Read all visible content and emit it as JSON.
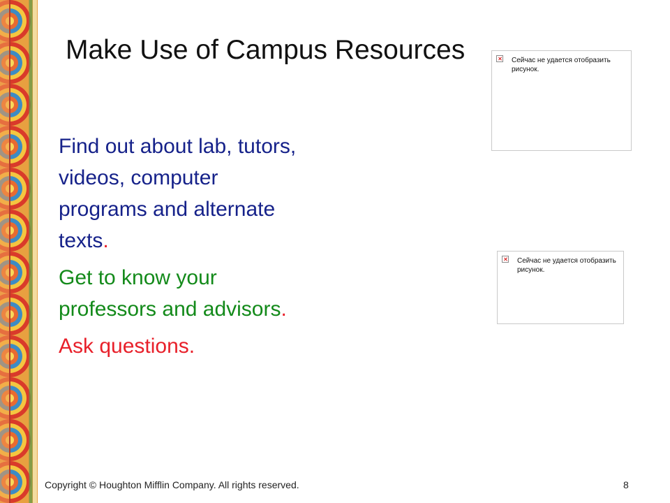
{
  "slide": {
    "title": "Make Use of Campus Resources",
    "bullets": [
      {
        "text": "Find out about lab, tutors, videos, computer programs and alternate texts",
        "end": "."
      },
      {
        "text": "Get to know your professors and advisors",
        "end": "."
      },
      {
        "text": "Ask questions.",
        "end": ""
      }
    ]
  },
  "images": [
    {
      "caption": "Сейчас не удается отобразить рисунок."
    },
    {
      "caption": "Сейчас не удается отобразить рисунок."
    }
  ],
  "footer": {
    "copyright": "Copyright © Houghton Mifflin Company. All rights reserved.",
    "page_number": "8"
  },
  "colors": {
    "title": "#111111",
    "bullet_blue": "#16228a",
    "bullet_green": "#138a1a",
    "bullet_red": "#e8202a"
  },
  "decoration": {
    "left_border": "colorful-circles-pattern"
  }
}
